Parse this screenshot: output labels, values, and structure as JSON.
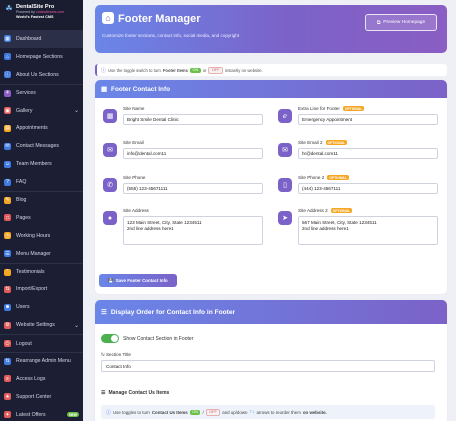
{
  "brand": {
    "name": "DentalSite Pro",
    "powered_prefix": "Powered by",
    "powered_by": "codeaibrains.com",
    "tagline": "World's Fastest CMS"
  },
  "sidebar": {
    "items": [
      {
        "label": "Dashboard",
        "icon": "dashboard-icon",
        "color": "#3f7ae0"
      },
      {
        "label": "Homepage Sections",
        "icon": "home-icon",
        "color": "#3f7ae0"
      },
      {
        "label": "About Us Sections",
        "icon": "info-icon",
        "color": "#3f7ae0"
      },
      {
        "label": "Services",
        "icon": "tooth-icon",
        "color": "#8a5ec4"
      },
      {
        "label": "Gallery",
        "icon": "image-icon",
        "color": "#e25a5a",
        "chevron": "⌄"
      },
      {
        "label": "Appointments",
        "icon": "calendar-icon",
        "color": "#f5a623"
      },
      {
        "label": "Contact Messages",
        "icon": "mail-icon",
        "color": "#3f7ae0"
      },
      {
        "label": "Team Members",
        "icon": "users-icon",
        "color": "#3f7ae0"
      },
      {
        "label": "FAQ",
        "icon": "question-icon",
        "color": "#3f7ae0"
      },
      {
        "label": "Blog",
        "icon": "blog-icon",
        "color": "#f5a623"
      },
      {
        "label": "Pages",
        "icon": "file-icon",
        "color": "#e25a5a"
      },
      {
        "label": "Working Hours",
        "icon": "clock-icon",
        "color": "#f5a623"
      },
      {
        "label": "Menu Manager",
        "icon": "menu-icon",
        "color": "#3f7ae0"
      },
      {
        "label": "Testimonials",
        "icon": "quote-icon",
        "color": "#f5a623"
      },
      {
        "label": "Import/Export",
        "icon": "import-icon",
        "color": "#e25a5a"
      },
      {
        "label": "Users",
        "icon": "user-icon",
        "color": "#3f7ae0"
      },
      {
        "label": "Website Settings",
        "icon": "gear-icon",
        "color": "#e25a5a",
        "chevron": "⌄"
      },
      {
        "label": "Logout",
        "icon": "logout-icon",
        "color": "#e25a5a"
      },
      {
        "label": "Rearrange Admin Menu",
        "icon": "sort-icon",
        "color": "#3f7ae0"
      },
      {
        "label": "Access Logs",
        "icon": "log-icon",
        "color": "#e25a5a"
      },
      {
        "label": "Support Center",
        "icon": "support-icon",
        "color": "#e25a5a"
      },
      {
        "label": "Latest Offers",
        "icon": "offer-icon",
        "color": "#e25a5a",
        "badge": "NEW"
      }
    ]
  },
  "header": {
    "title": "Footer Manager",
    "subtitle": "Customize footer sections, contact info, social media, and copyright",
    "preview_label": "Preview Homepage"
  },
  "info_bar": {
    "prefix": "Use the toggle switch to turn",
    "bold": "Footer Items",
    "on": "ON",
    "or": "or",
    "off": "OFF",
    "suffix": "instantly on website."
  },
  "contact_card": {
    "title": "Footer Contact Info",
    "optional": "OPTIONAL",
    "fields": {
      "site_name": {
        "label": "Site Name",
        "value": "Bright Smile Dental Clinic"
      },
      "extra_line": {
        "label": "Extra Line for Footer",
        "value": "Emergency Appointment"
      },
      "site_email": {
        "label": "Site Email",
        "value": "info@dental.com11"
      },
      "site_email_2": {
        "label": "Site Email 2",
        "value": "hr@dental.com11"
      },
      "site_phone": {
        "label": "Site Phone",
        "value": "(555) 123-45671111"
      },
      "site_phone_2": {
        "label": "Site Phone 2",
        "value": "(444) 123-4567111"
      },
      "site_address": {
        "label": "Site Address",
        "value": "123 Main Street, City, State 1234511\n2nd line address here1"
      },
      "site_address_2": {
        "label": "Site Address 2",
        "value": "567 Main Street, City, State 1234511\n2nd line address here1"
      }
    },
    "save_label": "Save Footer Contact Info"
  },
  "display_card": {
    "title": "Display Order for Contact Info in Footer",
    "toggle_label": "Show Contact Section in Footer",
    "toggle_on": true,
    "section_title_label": "Section Title",
    "section_title_value": "Contact Info",
    "manage_title": "Manage Contact Us Items",
    "manage_info": {
      "prefix": "Use toggles to turn",
      "bold": "Contact Us Items",
      "on": "ON",
      "slash": "/",
      "off": "OFF",
      "middle": "and up/down",
      "arrows": "↑↓",
      "suffix": "arrows to reorder them",
      "suffix_bold": "on website."
    }
  }
}
